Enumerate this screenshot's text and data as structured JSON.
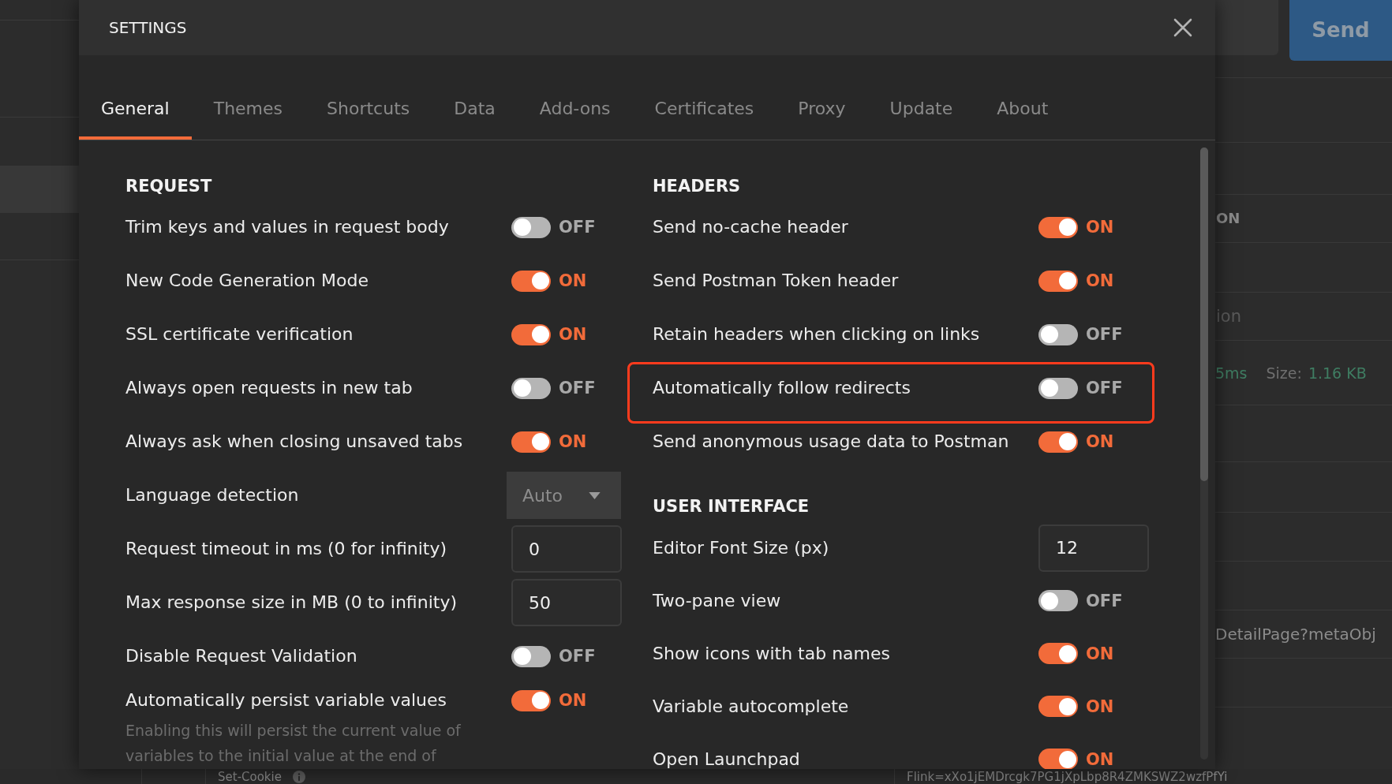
{
  "dialog": {
    "title": "SETTINGS"
  },
  "tabs": [
    {
      "label": "General",
      "selected": true
    },
    {
      "label": "Themes",
      "selected": false
    },
    {
      "label": "Shortcuts",
      "selected": false
    },
    {
      "label": "Data",
      "selected": false
    },
    {
      "label": "Add-ons",
      "selected": false
    },
    {
      "label": "Certificates",
      "selected": false
    },
    {
      "label": "Proxy",
      "selected": false
    },
    {
      "label": "Update",
      "selected": false
    },
    {
      "label": "About",
      "selected": false
    }
  ],
  "columns": [
    {
      "sections": [
        {
          "heading": "REQUEST",
          "items": [
            {
              "kind": "toggle",
              "label": "Trim keys and values in request body",
              "on": false,
              "state_text": "OFF"
            },
            {
              "kind": "toggle",
              "label": "New Code Generation Mode",
              "on": true,
              "state_text": "ON"
            },
            {
              "kind": "toggle",
              "label": "SSL certificate verification",
              "on": true,
              "state_text": "ON"
            },
            {
              "kind": "toggle",
              "label": "Always open requests in new tab",
              "on": false,
              "state_text": "OFF"
            },
            {
              "kind": "toggle",
              "label": "Always ask when closing unsaved tabs",
              "on": true,
              "state_text": "ON"
            },
            {
              "kind": "select",
              "label": "Language detection",
              "value": "Auto"
            },
            {
              "kind": "number",
              "label": "Request timeout in ms (0 for infinity)",
              "value": "0"
            },
            {
              "kind": "number",
              "label": "Max response size in MB (0 to infinity)",
              "value": "50"
            },
            {
              "kind": "toggle",
              "label": "Disable Request Validation",
              "on": false,
              "state_text": "OFF"
            },
            {
              "kind": "toggle",
              "label": "Automatically persist variable values",
              "on": true,
              "state_text": "ON",
              "description": "Enabling this will persist the current value of variables to the initial value at the end of"
            }
          ]
        }
      ]
    },
    {
      "sections": [
        {
          "heading": "HEADERS",
          "items": [
            {
              "kind": "toggle",
              "label": "Send no-cache header",
              "on": true,
              "state_text": "ON",
              "highlighted": false
            },
            {
              "kind": "toggle",
              "label": "Send Postman Token header",
              "on": true,
              "state_text": "ON",
              "highlighted": false
            },
            {
              "kind": "toggle",
              "label": "Retain headers when clicking on links",
              "on": false,
              "state_text": "OFF",
              "highlighted": false
            },
            {
              "kind": "toggle",
              "label": "Automatically follow redirects",
              "on": false,
              "state_text": "OFF",
              "highlighted": true
            },
            {
              "kind": "toggle",
              "label": "Send anonymous usage data to Postman",
              "on": true,
              "state_text": "ON",
              "highlighted": false
            }
          ]
        },
        {
          "heading": "USER INTERFACE",
          "items": [
            {
              "kind": "number",
              "label": "Editor Font Size (px)",
              "value": "12"
            },
            {
              "kind": "toggle",
              "label": "Two-pane view",
              "on": false,
              "state_text": "OFF"
            },
            {
              "kind": "toggle",
              "label": "Show icons with tab names",
              "on": true,
              "state_text": "ON"
            },
            {
              "kind": "toggle",
              "label": "Variable autocomplete",
              "on": true,
              "state_text": "ON"
            },
            {
              "kind": "toggle",
              "label": "Open Launchpad",
              "on": true,
              "state_text": "ON"
            }
          ]
        }
      ]
    }
  ],
  "background": {
    "send_button": "Send",
    "column_heading": "ON",
    "faded_text": "ion",
    "response_time": "5ms",
    "size_label": "Size:",
    "size_value": "1.16 KB",
    "url_text": "DetailPage?metaObj",
    "header_name": "Set-Cookie",
    "header_value": "Flink=xXo1jEMDrcgk7PG1jXpLbp8R4ZMKSWZ2wzfPfYi"
  }
}
